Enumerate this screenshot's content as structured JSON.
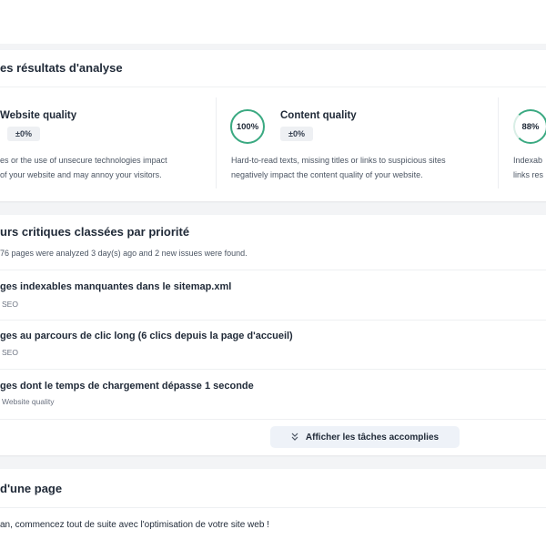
{
  "analysis": {
    "title": "es résultats d'analyse",
    "cards": [
      {
        "score": "",
        "title": "Website quality",
        "badge": "±0%",
        "desc_line1": "es or the use of unsecure technologies impact",
        "desc_line2": "of your website and may annoy your visitors."
      },
      {
        "score": "100%",
        "title": "Content quality",
        "badge": "±0%",
        "desc_line1": "Hard-to-read texts, missing titles or links to suspicious sites",
        "desc_line2": "negatively impact the content quality of your website."
      },
      {
        "score": "88%",
        "title": "",
        "badge": "",
        "desc_line1": "Indexab",
        "desc_line2": "links res"
      }
    ]
  },
  "errors": {
    "title": "urs critiques classées par priorité",
    "intro": "76 pages were analyzed 3 day(s) ago and 2 new issues were found.",
    "tasks": [
      {
        "title": "ges indexables manquantes dans le sitemap.xml",
        "tag": "SEO"
      },
      {
        "title": "ges au parcours de clic long (6 clics depuis la page d'accueil)",
        "tag": "SEO"
      },
      {
        "title": "ges dont le temps de chargement dépasse 1 seconde",
        "tag": "Website quality"
      }
    ],
    "show_completed_label": "Afficher les tâches accomplies"
  },
  "page_section": {
    "title": "d'une page",
    "text": "an,  commencez tout de suite avec l'optimisation de votre site web !"
  },
  "colors": {
    "accent_green": "#3aa981",
    "button_bg": "#eef2f8"
  },
  "icons": {
    "show_completed": "chevrons-down-icon"
  }
}
